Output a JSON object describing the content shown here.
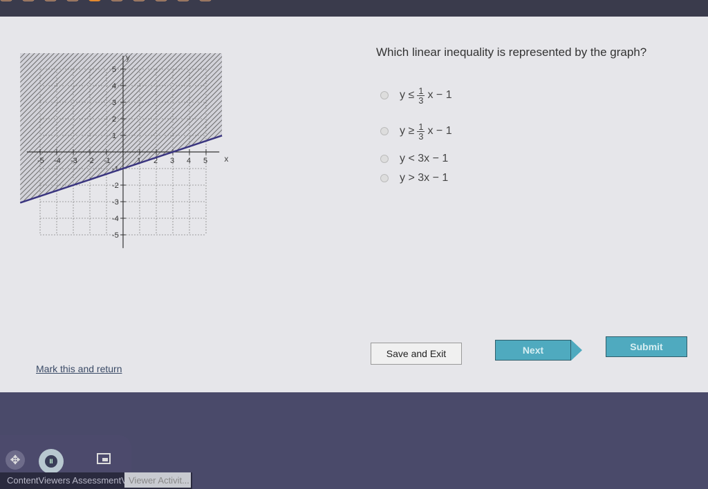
{
  "window": {
    "question_tabs_count": 10,
    "active_question_tab": 4
  },
  "question": {
    "text": "Which linear inequality is represented by the graph?",
    "options": [
      {
        "lhs": "y ≤",
        "num": "1",
        "den": "3",
        "rhs": "x − 1",
        "has_fraction": true
      },
      {
        "lhs": "y ≥",
        "num": "1",
        "den": "3",
        "rhs": "x − 1",
        "has_fraction": true
      },
      {
        "text": "y < 3x − 1",
        "has_fraction": false
      },
      {
        "text": "y > 3x − 1",
        "has_fraction": false
      }
    ]
  },
  "buttons": {
    "save_exit": "Save and Exit",
    "next": "Next",
    "submit": "Submit",
    "mark_return": "Mark this and return"
  },
  "dock": {
    "move_icon": "move-icon",
    "pause_icon": "pause-icon",
    "pip_icon": "picture-in-picture-icon",
    "pause_label": "II"
  },
  "taskbar": {
    "label": "ContentViewers AssessmentViewer",
    "tab": "Viewer Activit..."
  },
  "colors": {
    "accent": "#4faabf",
    "active_tab": "#e48a2e",
    "boundary_line": "#3a3580"
  },
  "chart_data": {
    "type": "line",
    "title": "",
    "xlabel": "x",
    "ylabel": "y",
    "xlim": [
      -5,
      5
    ],
    "ylim": [
      -5,
      5
    ],
    "x_ticks": [
      "-5",
      "-4",
      "-3",
      "-2",
      "-1",
      "1",
      "2",
      "3",
      "4",
      "5"
    ],
    "y_ticks": [
      "-5",
      "-4",
      "-3",
      "-2",
      "-1",
      "1",
      "2",
      "3",
      "4",
      "5"
    ],
    "grid": true,
    "boundary": {
      "slope": 0.3333,
      "intercept": -1,
      "style": "solid"
    },
    "shaded_region": "above",
    "points_on_line": [
      [
        0,
        -1
      ],
      [
        3,
        0
      ]
    ]
  }
}
